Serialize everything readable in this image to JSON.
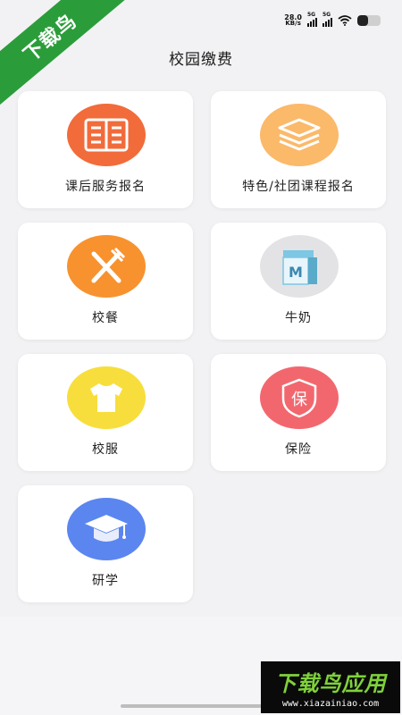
{
  "status_bar": {
    "net_speed": "28.0",
    "net_unit": "KB/s",
    "sim1_label": "5G",
    "sim2_label": "5G",
    "battery_level": 0.45
  },
  "corner_banner": {
    "text": "下载鸟"
  },
  "header": {
    "title": "校园缴费"
  },
  "services": [
    {
      "label": "课后服务报名",
      "icon": "book-icon",
      "color": "#f26b3a"
    },
    {
      "label": "特色/社团课程报名",
      "icon": "layers-icon",
      "color": "#fbb96a"
    },
    {
      "label": "校餐",
      "icon": "fork-knife-icon",
      "color": "#f7922f"
    },
    {
      "label": "牛奶",
      "icon": "milk-carton-icon",
      "color": "#e3e3e6"
    },
    {
      "label": "校服",
      "icon": "tshirt-icon",
      "color": "#f7de3c"
    },
    {
      "label": "保险",
      "icon": "insurance-shield-icon",
      "color": "#f2676e"
    },
    {
      "label": "研学",
      "icon": "graduation-cap-icon",
      "color": "#5b86f0"
    }
  ],
  "insurance_icon_char": "保",
  "milk_icon_char": "M",
  "watermark": {
    "title": "下载鸟应用",
    "url": "www.xiazainiao.com"
  },
  "colors": {
    "accent_green": "#2a9d3a",
    "background": "#f2f2f4",
    "card": "#ffffff"
  }
}
